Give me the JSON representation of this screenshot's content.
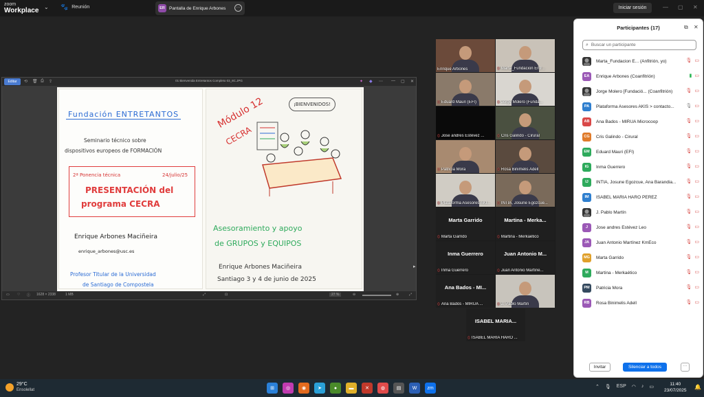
{
  "app": {
    "brand_line1": "zoom",
    "brand_line2": "Workplace",
    "tab_meeting": "Reunión",
    "share_badge": "ER",
    "share_tab": "Pantalla de Enrique Arbones",
    "signin": "Iniciar sesión"
  },
  "shared_doc": {
    "edit_label": "Editar",
    "title": "01 Bienvenida Entretantos Completo 03_8C.JPG",
    "status_left": "1628 × 2338",
    "status_size": "1 MB",
    "zoom": "27 %",
    "left_panel": {
      "org": "Fundación ENTRETANTOS",
      "seminar1": "Seminario técnico sobre",
      "seminar2": "dispositivos europeos de FORMACIÓN",
      "ponencia": "2ª Ponencia técnica",
      "date": "24/julio/25",
      "pres1": "PRESENTACIÓN del",
      "pres2": "programa CECRA",
      "speaker": "Enrique Arbones Maciñeira",
      "email": "enrique_arbones@usc.es",
      "role1": "Profesor Titular de la Universidad",
      "role2": "de Santiago de Compostela"
    },
    "right_panel": {
      "module": "Módulo 12",
      "cecra": "CECRA",
      "welcome": "¡BIENVENIDOS!",
      "topic1": "Asesoramiento y apoyo",
      "topic2": "de GRUPOS y EQUIPOS",
      "author": "Enrique Arbones Maciñeira",
      "place": "Santiago  3 y 4 de junio de 2025"
    }
  },
  "gallery": [
    {
      "name": "Enrique Arbones",
      "type": "video",
      "bg": "#6b4a3a",
      "active": true
    },
    {
      "name": "Marta_Fundacion Entr...",
      "type": "video",
      "bg": "#c9c2b8"
    },
    {
      "name": "Eduard Mauri (EFI)",
      "type": "video",
      "bg": "#8a7a6a"
    },
    {
      "name": "Jorge Molero (Funda...",
      "type": "video",
      "bg": "#d9d6d0"
    },
    {
      "name": "Jose andres Estévez ...",
      "type": "dark",
      "bg": "#0a0a0a"
    },
    {
      "name": "Cris Galindo - Cirural",
      "type": "video",
      "bg": "#4a5040"
    },
    {
      "name": "Patricia Mora",
      "type": "video",
      "bg": "#a88a70"
    },
    {
      "name": "Rosa Binimelis Adell",
      "type": "video",
      "bg": "#5a4a3e"
    },
    {
      "name": "Plataforma Asesores AKI...",
      "type": "video",
      "bg": "#d0ccc4"
    },
    {
      "name": "INTIA, Josune Egozcue...",
      "type": "video",
      "bg": "#7a6a5a"
    },
    {
      "name": "Marta Garrido",
      "type": "text",
      "big": "Marta Garrido"
    },
    {
      "name": "Martina - Merkaético",
      "type": "text",
      "big": "Martina - Merka..."
    },
    {
      "name": "Inma Guerrero",
      "type": "text",
      "big": "Inma Guerrero"
    },
    {
      "name": "Juan Antonio Martíne...",
      "type": "text",
      "big": "Juan Antonio M..."
    },
    {
      "name": "Ana Bados - MIRUA ...",
      "type": "text",
      "big": "Ana Bados - MI..."
    },
    {
      "name": "J. Pablo Martín",
      "type": "video",
      "bg": "#c8c4bc"
    },
    {
      "name": "ISABEL MARIA HARO ...",
      "type": "text",
      "big": "ISABEL MARIA..."
    }
  ],
  "panel": {
    "title": "Participantes (17)",
    "search_placeholder": "Buscar un participante",
    "invite": "Invitar",
    "mute_all": "Silenciar a todos",
    "more": "···",
    "participants": [
      {
        "initials": "",
        "color": "#333333",
        "name": "Marta_Fundacion E... (Anfitrión, yo)",
        "photo": true,
        "mic": "red"
      },
      {
        "initials": "EA",
        "color": "#9b59b6",
        "name": "Enrique Arbones (Coanfitrión)",
        "mic": "green"
      },
      {
        "initials": "",
        "color": "#333333",
        "name": "Jorge Molero [Fundació... (Coanfitrión)",
        "photo": true,
        "mic": "red"
      },
      {
        "initials": "PA",
        "color": "#2f7fcf",
        "name": "Plataforma Asesores AKIS > contacto...",
        "mic": "grey"
      },
      {
        "initials": "AB",
        "color": "#d94848",
        "name": "Ana Bados - MIRUA Microcoop",
        "mic": "red"
      },
      {
        "initials": "CG",
        "color": "#e07b2b",
        "name": "Cris Galindo - Cirural",
        "mic": "red"
      },
      {
        "initials": "EM",
        "color": "#2eaa5c",
        "name": "Eduard Mauri (EFI)",
        "mic": "red"
      },
      {
        "initials": "IG",
        "color": "#2eaa5c",
        "name": "Inma Guerrero",
        "mic": "red"
      },
      {
        "initials": "IJ",
        "color": "#2eaa5c",
        "name": "INTIA, Josune Egozcue, Ana Barandia...",
        "mic": "red"
      },
      {
        "initials": "IM",
        "color": "#2f7fcf",
        "name": "ISABEL MARIA HARO PEREZ",
        "mic": "red"
      },
      {
        "initials": "",
        "color": "#333333",
        "name": "J. Pablo Martín",
        "photo": true,
        "mic": "red"
      },
      {
        "initials": "J",
        "color": "#9b59b6",
        "name": "Jose andres Estévez Leo",
        "mic": "red"
      },
      {
        "initials": "JA",
        "color": "#9b59b6",
        "name": "Juan Antonio Martínez KmEco",
        "mic": "red"
      },
      {
        "initials": "MG",
        "color": "#e0a02b",
        "name": "Marta Garrido",
        "mic": "red"
      },
      {
        "initials": "M",
        "color": "#2eaa5c",
        "name": "Martina - Merkaético",
        "mic": "red"
      },
      {
        "initials": "PM",
        "color": "#34495e",
        "name": "Patricia Mora",
        "mic": "red"
      },
      {
        "initials": "RB",
        "color": "#9b59b6",
        "name": "Rosa Binimelis Adell",
        "mic": "red"
      }
    ]
  },
  "taskbar": {
    "temp": "29°C",
    "weather": "Ensolellat",
    "lang": "ESP",
    "time": "11:40",
    "date": "23/07/2025"
  }
}
